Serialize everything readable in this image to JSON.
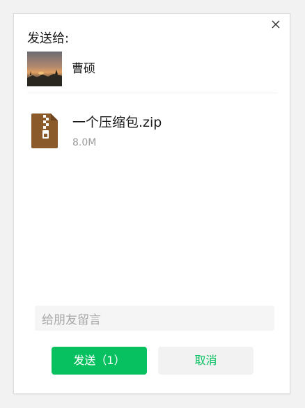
{
  "dialog": {
    "send_to_label": "发送给:",
    "recipient": {
      "name": "曹硕",
      "avatar": "sunset-photo"
    },
    "file": {
      "name": "一个压缩包.zip",
      "size": "8.0M",
      "icon": "zip-file-icon",
      "icon_color": "#8b5a2b"
    },
    "message_placeholder": "给朋友留言",
    "send_button": "发送（1）",
    "cancel_button": "取消",
    "close_icon": "close-icon"
  },
  "colors": {
    "accent": "#07c160",
    "background": "#f2f2f2",
    "secondary_text": "#9a9a9a"
  }
}
